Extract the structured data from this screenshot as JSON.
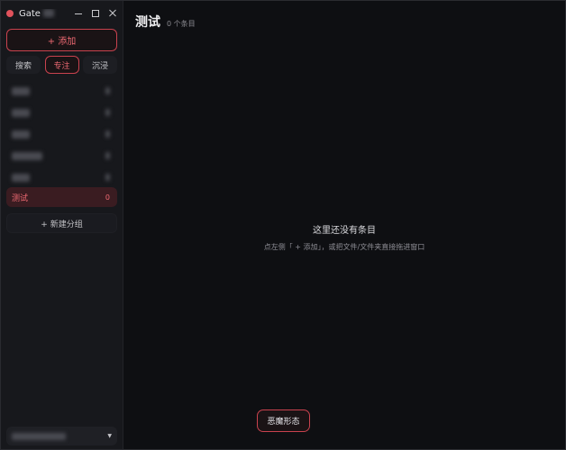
{
  "window": {
    "app_title": "Gate"
  },
  "sidebar": {
    "add_label": "+ 添加",
    "tabs": [
      {
        "label": "搜索"
      },
      {
        "label": "专注"
      },
      {
        "label": "沉浸"
      }
    ],
    "selected_group": {
      "label": "测试",
      "count": "0"
    },
    "new_group_label": "+ 新建分组"
  },
  "main": {
    "title": "测试",
    "count_text": "0 个条目",
    "empty_title": "这里还没有条目",
    "empty_hint": "点左侧「 + 添加」，或把文件/文件夹直接拖进窗口",
    "mode_button": "恶魔形态"
  },
  "colors": {
    "accent": "#e0525c",
    "background": "#0e0f12",
    "sidebar": "#17181c"
  }
}
